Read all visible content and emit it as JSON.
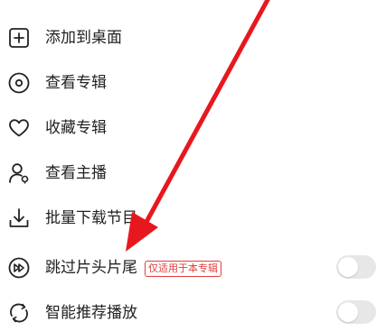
{
  "menu": {
    "items": [
      {
        "label": "添加到桌面",
        "icon": "add-square-icon"
      },
      {
        "label": "查看专辑",
        "icon": "disc-icon"
      },
      {
        "label": "收藏专辑",
        "icon": "heart-icon"
      },
      {
        "label": "查看主播",
        "icon": "user-icon"
      },
      {
        "label": "批量下载节目",
        "icon": "download-icon"
      },
      {
        "label": "跳过片头片尾",
        "icon": "skip-forward-icon",
        "badge": "仅适用于本专辑",
        "toggle": false
      },
      {
        "label": "智能推荐播放",
        "icon": "repeat-icon",
        "toggle": false
      }
    ]
  },
  "colors": {
    "annotation_arrow": "#e8171e",
    "badge": "#e23b3b",
    "toggle_off": "#e7e7e7"
  }
}
